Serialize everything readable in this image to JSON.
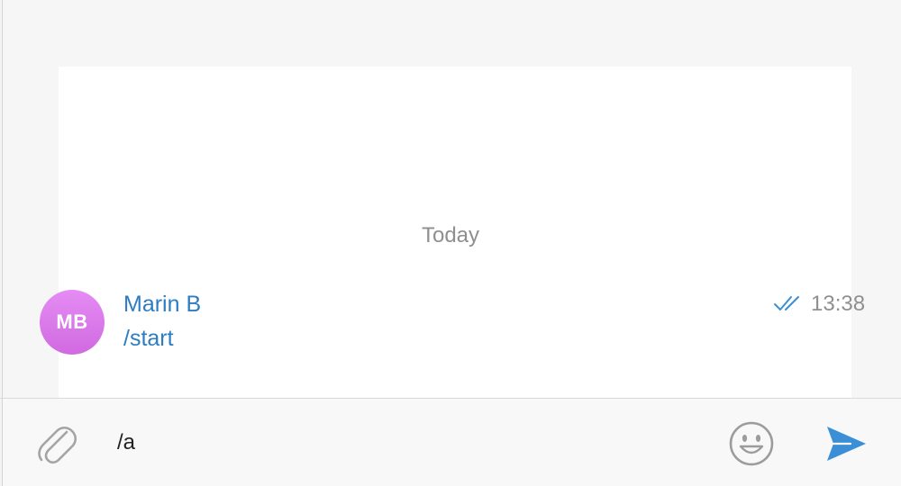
{
  "chat": {
    "date_separator": "Today",
    "messages": [
      {
        "sender": "Marin B",
        "avatar_initials": "MB",
        "text": "/start",
        "time": "13:38",
        "status_icon": "double-check-icon"
      }
    ]
  },
  "composer": {
    "input_value": "/a",
    "attach_icon": "paperclip-icon",
    "emoji_icon": "smiley-icon",
    "send_icon": "send-arrow-icon"
  },
  "colors": {
    "accent": "#2d7dc2",
    "avatar": "#dc79ec",
    "send": "#3b8fd6",
    "muted": "#8f8f8f"
  }
}
